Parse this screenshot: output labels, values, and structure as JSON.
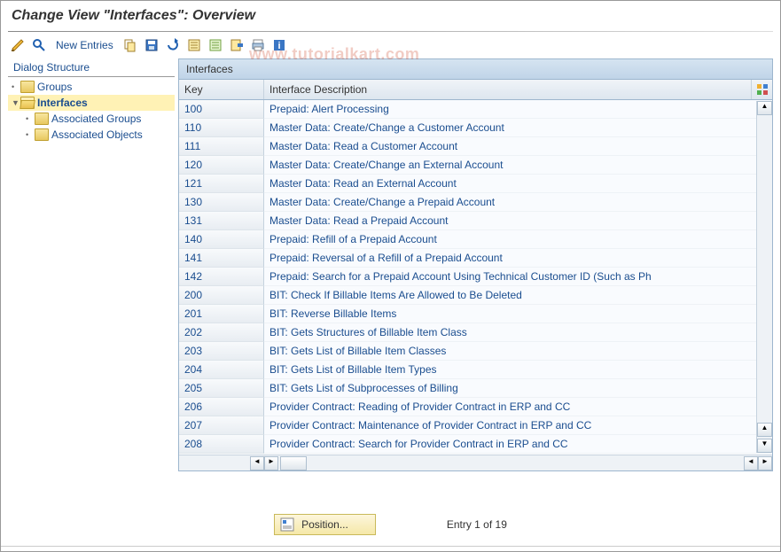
{
  "title": "Change View \"Interfaces\": Overview",
  "watermark": "www.tutorialkart.com",
  "toolbar": {
    "new_entries": "New Entries"
  },
  "sidebar": {
    "title": "Dialog Structure",
    "items": [
      {
        "label": "Groups"
      },
      {
        "label": "Interfaces"
      },
      {
        "label": "Associated Groups"
      },
      {
        "label": "Associated Objects"
      }
    ]
  },
  "table": {
    "title": "Interfaces",
    "col_key": "Key",
    "col_desc": "Interface Description",
    "rows": [
      {
        "key": "100",
        "desc": "Prepaid: Alert Processing"
      },
      {
        "key": "110",
        "desc": "Master Data: Create/Change a Customer Account"
      },
      {
        "key": "111",
        "desc": "Master Data: Read a Customer Account"
      },
      {
        "key": "120",
        "desc": "Master Data: Create/Change an External Account"
      },
      {
        "key": "121",
        "desc": "Master Data: Read an External Account"
      },
      {
        "key": "130",
        "desc": "Master Data: Create/Change a Prepaid Account"
      },
      {
        "key": "131",
        "desc": "Master Data: Read a Prepaid Account"
      },
      {
        "key": "140",
        "desc": "Prepaid: Refill of a Prepaid Account"
      },
      {
        "key": "141",
        "desc": "Prepaid: Reversal of a Refill of a Prepaid Account"
      },
      {
        "key": "142",
        "desc": "Prepaid: Search for a Prepaid Account Using Technical Customer ID (Such as Ph"
      },
      {
        "key": "200",
        "desc": "BIT: Check If Billable Items Are Allowed to Be Deleted"
      },
      {
        "key": "201",
        "desc": "BIT: Reverse Billable Items"
      },
      {
        "key": "202",
        "desc": "BIT: Gets Structures of Billable Item Class"
      },
      {
        "key": "203",
        "desc": "BIT: Gets List of Billable Item Classes"
      },
      {
        "key": "204",
        "desc": "BIT: Gets List of Billable Item Types"
      },
      {
        "key": "205",
        "desc": "BIT: Gets List of Subprocesses of Billing"
      },
      {
        "key": "206",
        "desc": "Provider Contract: Reading of Provider Contract in ERP and CC"
      },
      {
        "key": "207",
        "desc": "Provider Contract: Maintenance of Provider Contract in ERP and CC"
      },
      {
        "key": "208",
        "desc": "Provider Contract: Search for Provider Contract in ERP and CC"
      }
    ]
  },
  "footer": {
    "position_label": "Position...",
    "entry_label": "Entry 1 of 19"
  }
}
